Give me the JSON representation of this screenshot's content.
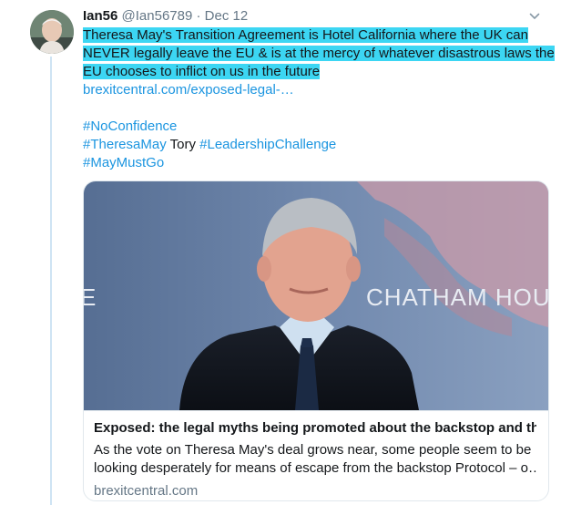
{
  "tweet": {
    "author_name": "Ian56",
    "handle": "@Ian56789",
    "separator": "·",
    "date": "Dec 12",
    "highlighted_lines": [
      "Theresa May's Transition Agreement is Hotel California where the UK can",
      "NEVER legally leave the EU & is at the mercy of whatever disastrous laws the",
      "EU chooses to inflict on us in the future"
    ],
    "link": "brexitcentral.com/exposed-legal-…",
    "hashtags": {
      "no_confidence": "#NoConfidence",
      "theresa_may": "#TheresaMay",
      "tory": "Tory",
      "leadership": "#LeadershipChallenge",
      "may_must_go": "#MayMustGo"
    }
  },
  "card": {
    "title": "Exposed: the legal myths being promoted about the backstop and th…",
    "description_lines": [
      "As the vote on Theresa May's deal grows near, some people seem to be",
      "looking desperately for means of escape from the backstop Protocol – o…"
    ],
    "domain": "brexitcentral.com",
    "image_backdrop_text": "CHATHAM HOUS",
    "image_backdrop_left_letter": "E"
  },
  "colors": {
    "highlight": "#3cd6f3",
    "link": "#1b95e0",
    "thread_line": "#cfe4f3",
    "secondary_text": "#657786"
  }
}
